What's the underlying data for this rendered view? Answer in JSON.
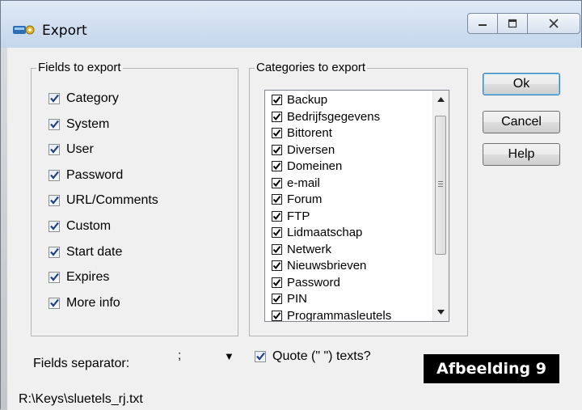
{
  "window": {
    "title": "Export",
    "controls": {
      "minimize": "—",
      "maximize": "□",
      "close": "✕"
    }
  },
  "fields_group": {
    "legend": "Fields to export",
    "items": [
      {
        "label": "Category",
        "checked": true
      },
      {
        "label": "System",
        "checked": true
      },
      {
        "label": "User",
        "checked": true
      },
      {
        "label": "Password",
        "checked": true
      },
      {
        "label": "URL/Comments",
        "checked": true
      },
      {
        "label": "Custom",
        "checked": true
      },
      {
        "label": "Start date",
        "checked": true
      },
      {
        "label": "Expires",
        "checked": true
      },
      {
        "label": "More info",
        "checked": true
      }
    ]
  },
  "categories_group": {
    "legend": "Categories to export",
    "items": [
      {
        "label": "Backup",
        "checked": true
      },
      {
        "label": "Bedrijfsgegevens",
        "checked": true
      },
      {
        "label": "Bittorent",
        "checked": true
      },
      {
        "label": "Diversen",
        "checked": true
      },
      {
        "label": "Domeinen",
        "checked": true
      },
      {
        "label": "e-mail",
        "checked": true
      },
      {
        "label": "Forum",
        "checked": true
      },
      {
        "label": "FTP",
        "checked": true
      },
      {
        "label": "Lidmaatschap",
        "checked": true
      },
      {
        "label": "Netwerk",
        "checked": true
      },
      {
        "label": "Nieuwsbrieven",
        "checked": true
      },
      {
        "label": "Password",
        "checked": true
      },
      {
        "label": "PIN",
        "checked": true
      },
      {
        "label": "Programmasleutels",
        "checked": true
      }
    ]
  },
  "buttons": {
    "ok": "Ok",
    "cancel": "Cancel",
    "help": "Help"
  },
  "separator": {
    "label": "Fields separator:",
    "value": ";"
  },
  "quote_option": {
    "label": "Quote (\" \") texts?",
    "checked": true
  },
  "status_path": "R:\\Keys\\sluetels_rj.txt",
  "caption": "Afbeelding 9",
  "colors": {
    "checkmark": "#1f3f86",
    "caption_bg": "#000000",
    "titlebar": "#c4d6ec"
  }
}
